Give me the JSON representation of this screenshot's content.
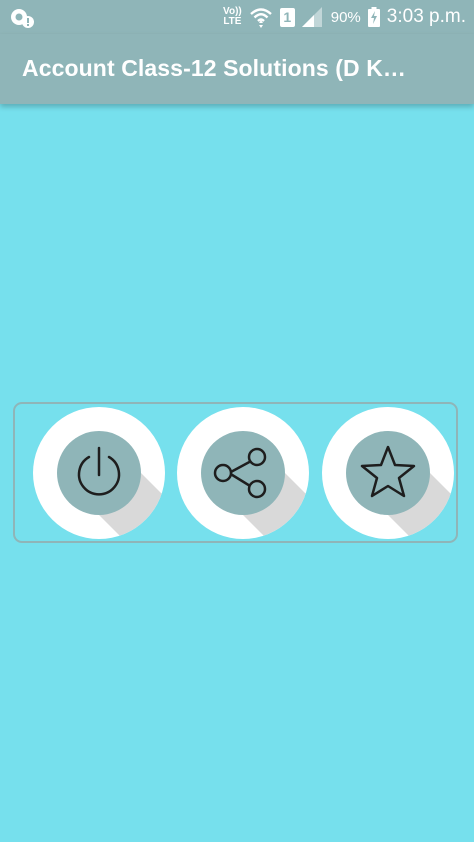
{
  "status_bar": {
    "left_icon": "data-saver-notification-icon",
    "network_label": "Vo)) LTE",
    "wifi_icon": "wifi-icon",
    "sim_slot": "1",
    "signal_icon": "cell-signal-icon",
    "battery_percent": "90%",
    "battery_icon": "battery-charging-icon",
    "time": "3:03 p.m."
  },
  "app_bar": {
    "title": "Account Class-12 Solutions (D K…"
  },
  "buttons": [
    {
      "icon": "power-icon"
    },
    {
      "icon": "share-icon"
    },
    {
      "icon": "star-icon"
    }
  ],
  "colors": {
    "background": "#76e0ed",
    "bar": "#8fb5b8",
    "button_face": "#8fb5b8",
    "button_ring": "#ffffff",
    "long_shadow": "#d9d9d9",
    "icon_stroke": "#1e1e1e"
  }
}
